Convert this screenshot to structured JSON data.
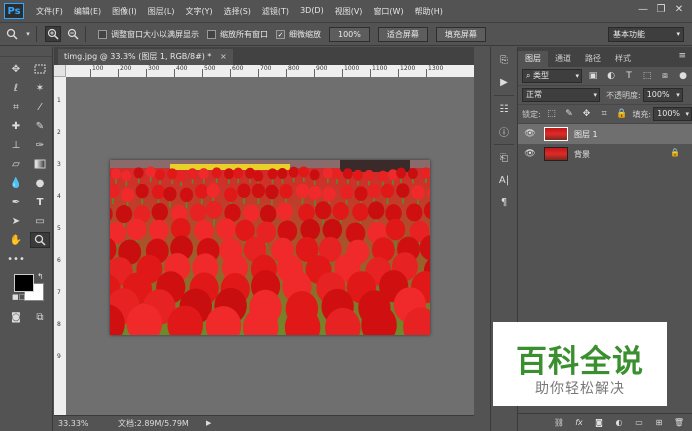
{
  "app": {
    "logo": "Ps"
  },
  "menu": [
    "文件(F)",
    "编辑(E)",
    "图像(I)",
    "图层(L)",
    "文字(Y)",
    "选择(S)",
    "滤镜(T)",
    "3D(D)",
    "视图(V)",
    "窗口(W)",
    "帮助(H)"
  ],
  "window_controls": {
    "minimize": "—",
    "restore": "❐",
    "close": "✕"
  },
  "options": {
    "resize_window_label": "调整窗口大小以满屏显示",
    "zoom_all_label": "缩放所有窗口",
    "scrubby_zoom_label": "细微缩放",
    "scrubby_zoom_checked": "✓",
    "zoom_percent": "100%",
    "fit_screen": "适合屏幕",
    "fill_screen": "填充屏幕",
    "workspace": "基本功能"
  },
  "document": {
    "tab_title": "timg.jpg @ 33.3% (图层 1, RGB/8#) *",
    "close": "×",
    "ruler_top_ticks": [
      "100",
      "200",
      "300",
      "400",
      "500",
      "600",
      "700",
      "800",
      "900",
      "1000",
      "1100",
      "1200",
      "1300"
    ],
    "ruler_left_ticks": [
      "1",
      "2",
      "3",
      "4",
      "5",
      "6",
      "7",
      "8",
      "9"
    ]
  },
  "status": {
    "zoom": "33.33%",
    "doc_size": "文档:2.89M/5.79M",
    "arrow": "▶"
  },
  "layers_panel": {
    "tabs": [
      "图层",
      "通道",
      "路径",
      "样式"
    ],
    "filter_kind": "类型",
    "blend_mode": "正常",
    "opacity_label": "不透明度:",
    "opacity_value": "100%",
    "lock_label": "锁定:",
    "fill_label": "填充:",
    "fill_value": "100%",
    "layers": [
      {
        "name": "图层 1",
        "selected": true
      },
      {
        "name": "背景",
        "selected": false
      }
    ]
  },
  "watermark": {
    "title": "百科全说",
    "subtitle": "助你轻松解决"
  }
}
